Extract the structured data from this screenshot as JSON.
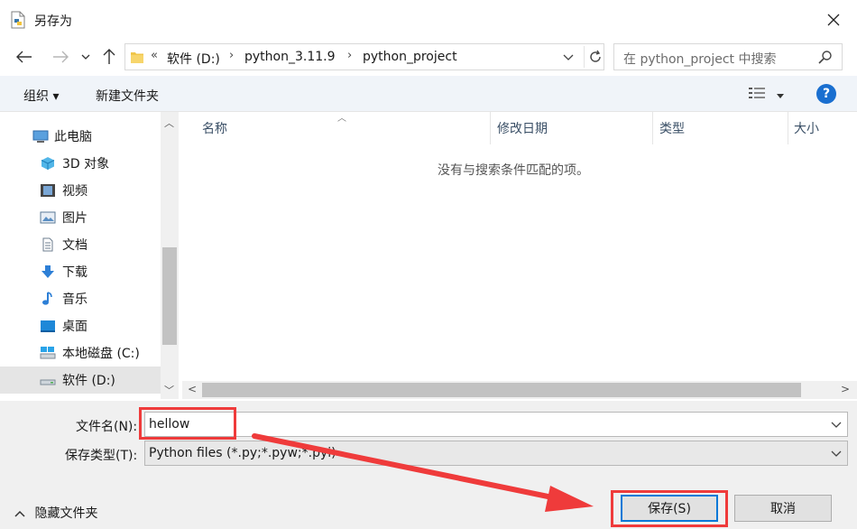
{
  "window": {
    "title": "另存为"
  },
  "address": {
    "overflow": "«",
    "crumbs": [
      "软件 (D:)",
      "python_3.11.9",
      "python_project"
    ]
  },
  "search": {
    "placeholder": "在 python_project 中搜索"
  },
  "toolbar": {
    "organize": "组织 ▾",
    "new_folder": "新建文件夹",
    "help": "?"
  },
  "nav_pane": {
    "items": [
      {
        "label": "此电脑",
        "icon": "computer-icon"
      },
      {
        "label": "3D 对象",
        "icon": "cube-3d-icon"
      },
      {
        "label": "视频",
        "icon": "video-icon"
      },
      {
        "label": "图片",
        "icon": "picture-icon"
      },
      {
        "label": "文档",
        "icon": "document-icon"
      },
      {
        "label": "下载",
        "icon": "download-icon"
      },
      {
        "label": "音乐",
        "icon": "music-icon"
      },
      {
        "label": "桌面",
        "icon": "desktop-icon"
      },
      {
        "label": "本地磁盘 (C:)",
        "icon": "drive-c-icon"
      },
      {
        "label": "软件 (D:)",
        "icon": "drive-d-icon"
      }
    ],
    "selected": "软件 (D:)"
  },
  "file_list": {
    "columns": [
      "名称",
      "修改日期",
      "类型",
      "大小"
    ],
    "empty_message": "没有与搜索条件匹配的项。"
  },
  "save_form": {
    "filename_label": "文件名(N):",
    "filename_value": "hellow",
    "type_label": "保存类型(T):",
    "type_value": "Python files (*.py;*.pyw;*.pyi)"
  },
  "footer": {
    "hide_folders": "隐藏文件夹"
  },
  "buttons": {
    "save": "保存(S)",
    "cancel": "取消"
  },
  "colors": {
    "annotation": "#ef3b3b",
    "accent": "#0078d7"
  }
}
